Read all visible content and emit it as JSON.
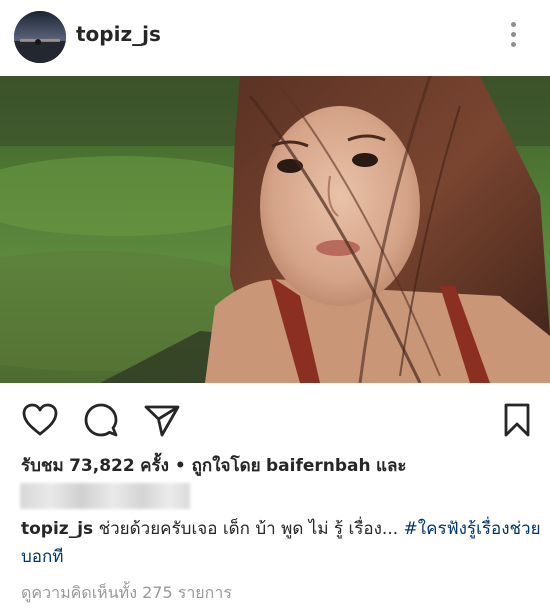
{
  "post": {
    "username": "topiz_js",
    "likes_prefix": "รับชม",
    "view_count": "73,822",
    "likes_mid": "ครั้ง • ถูกใจโดย",
    "liked_by": "baifernbah",
    "likes_suffix": "และ",
    "caption_user": "topiz_js",
    "caption_text": "ช่วยด้วยครับเจอ เด็ก บ้า พูด ไม่ รู้ เรื่อง...",
    "caption_hashtag": "#ใครฟังรู้เรื่องช่วยบอกที",
    "view_comments": "ดูความคิดเห็นทั้ง 275 รายการ"
  },
  "icons": {
    "more": "more-vertical-icon",
    "like": "heart-icon",
    "comment": "comment-icon",
    "share": "send-icon",
    "save": "bookmark-icon"
  },
  "colors": {
    "text": "#262626",
    "hashtag": "#003569",
    "muted": "#999999"
  }
}
